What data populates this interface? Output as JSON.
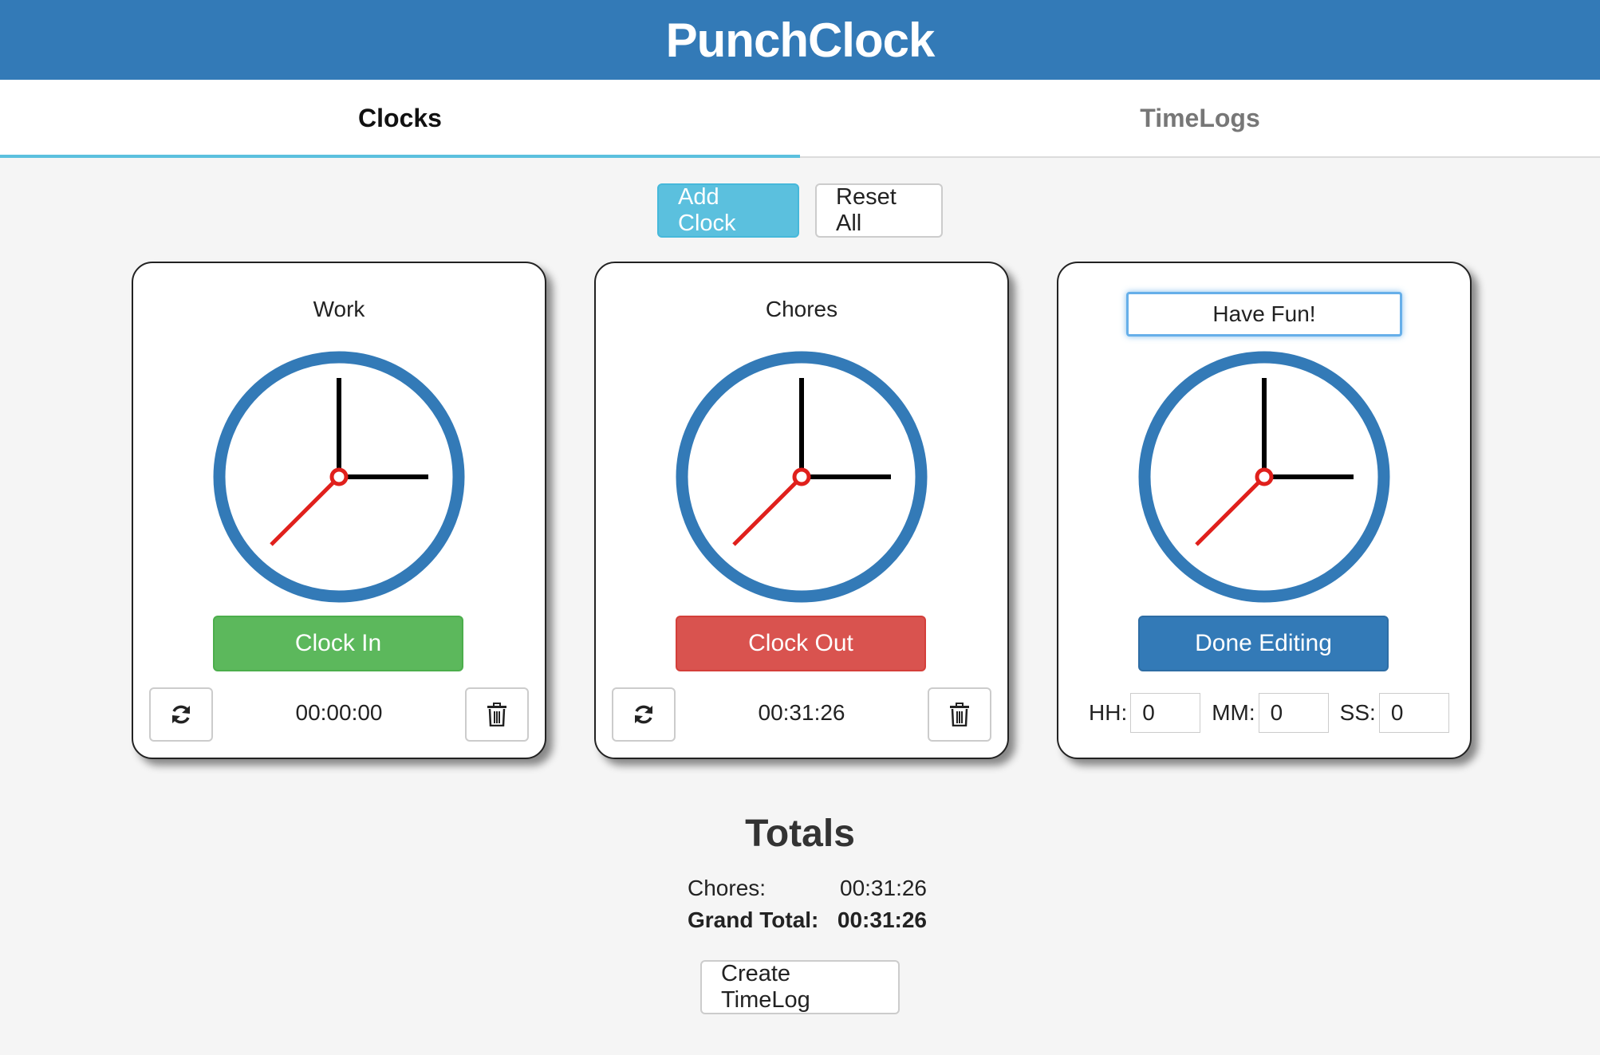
{
  "app": {
    "title": "PunchClock"
  },
  "tabs": [
    {
      "label": "Clocks",
      "active": true
    },
    {
      "label": "TimeLogs",
      "active": false
    }
  ],
  "actions": {
    "add_clock": "Add Clock",
    "reset_all": "Reset All"
  },
  "clocks": [
    {
      "name": "Work",
      "button_label": "Clock In",
      "button_state": "success",
      "elapsed": "00:00:00",
      "editing": false
    },
    {
      "name": "Chores",
      "button_label": "Clock Out",
      "button_state": "danger",
      "elapsed": "00:31:26",
      "editing": false
    },
    {
      "name": "Have Fun!",
      "button_label": "Done Editing",
      "button_state": "primary",
      "editing": true,
      "edit_fields": {
        "hh_label": "HH:",
        "hh_value": "0",
        "mm_label": "MM:",
        "mm_value": "0",
        "ss_label": "SS:",
        "ss_value": "0"
      }
    }
  ],
  "totals": {
    "title": "Totals",
    "rows": [
      {
        "label": "Chores:",
        "value": "00:31:26"
      }
    ],
    "grand_total": {
      "label": "Grand Total:",
      "value": "00:31:26"
    }
  },
  "create_timelog": "Create TimeLog",
  "colors": {
    "brand": "#337ab7",
    "info": "#5bc0de",
    "success": "#5cb85c",
    "danger": "#d9534f",
    "clock_ring": "#337ab7",
    "second_hand": "#e0201c"
  },
  "icons": {
    "refresh": "refresh-icon",
    "delete": "trash-icon"
  }
}
